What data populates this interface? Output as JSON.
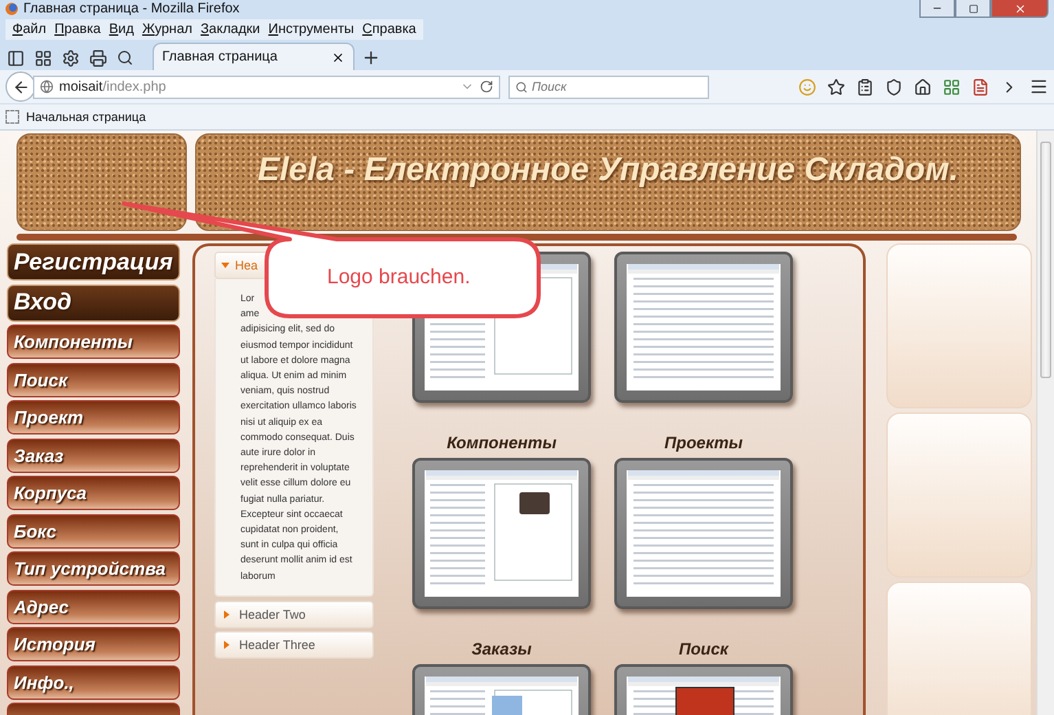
{
  "window": {
    "title": "Главная страница - Mozilla Firefox"
  },
  "menu": [
    "Файл",
    "Правка",
    "Вид",
    "Журнал",
    "Закладки",
    "Инструменты",
    "Справка"
  ],
  "tab": {
    "title": "Главная страница"
  },
  "address_bar": {
    "host": "moisait",
    "path": "/index.php"
  },
  "search": {
    "placeholder": "Поиск"
  },
  "bookmarks": [
    "Начальная страница"
  ],
  "site": {
    "title": "Elela - Електронное Управление Складом."
  },
  "nav": [
    {
      "label": "Регистрация",
      "kind": "dark"
    },
    {
      "label": "Вход",
      "kind": "dark"
    },
    {
      "label": "Компоненты",
      "kind": "light"
    },
    {
      "label": "Поиск",
      "kind": "light"
    },
    {
      "label": "Проект",
      "kind": "light"
    },
    {
      "label": "Заказ",
      "kind": "light"
    },
    {
      "label": "Корпуса",
      "kind": "light"
    },
    {
      "label": "Бокс",
      "kind": "light"
    },
    {
      "label": "Тип устройства",
      "kind": "light"
    },
    {
      "label": "Адрес",
      "kind": "light"
    },
    {
      "label": "История",
      "kind": "light"
    },
    {
      "label": "Инфо.,",
      "kind": "light"
    },
    {
      "kind": "light"
    }
  ],
  "accordion": {
    "items": [
      {
        "title": "Hea",
        "expanded": true,
        "body": [
          "Lor",
          "ame",
          "adipisicing elit, sed do",
          "eiusmod tempor incididunt",
          "ut labore et dolore magna",
          "aliqua. Ut enim ad minim",
          "veniam, quis nostrud",
          "exercitation ullamco laboris",
          "nisi ut aliquip ex ea",
          "commodo consequat. Duis",
          "aute irure dolor in",
          "reprehenderit in voluptate",
          "velit esse cillum dolore eu",
          "fugiat nulla pariatur.",
          "Excepteur sint occaecat",
          "cupidatat non proident,",
          "sunt in culpa qui officia",
          "deserunt mollit anim id est",
          "laborum"
        ]
      },
      {
        "title": "Header Two",
        "expanded": false
      },
      {
        "title": "Header Three",
        "expanded": false
      }
    ]
  },
  "gallery": {
    "captions": [
      "Компоненты",
      "Проекты",
      "Заказы",
      "Поиск"
    ]
  },
  "callout": {
    "text": "Logo brauchen."
  }
}
